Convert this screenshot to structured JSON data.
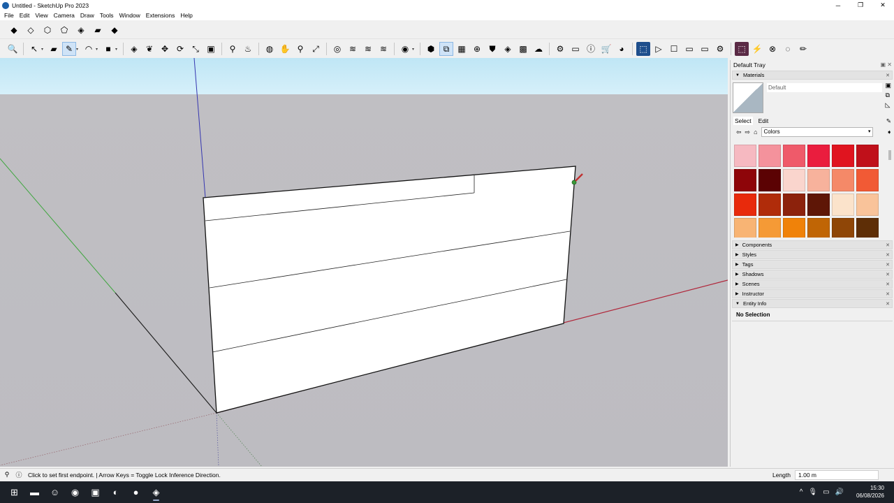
{
  "window": {
    "title": "Untitled - SketchUp Pro 2023",
    "minimize": "─",
    "maximize": "❐",
    "close": "✕"
  },
  "menu": [
    "File",
    "Edit",
    "View",
    "Camera",
    "Draw",
    "Tools",
    "Window",
    "Extensions",
    "Help"
  ],
  "toolbar1": {
    "icons": [
      "iso-view-icon",
      "top-view-icon",
      "front-view-icon",
      "right-view-icon",
      "back-view-icon",
      "left-view-icon",
      "bottom-view-icon"
    ],
    "glyphs": [
      "◆",
      "◇",
      "⬡",
      "⬠",
      "◈",
      "▰",
      "◆"
    ]
  },
  "toolbar2": {
    "groups": [
      [
        {
          "name": "zoom-icon",
          "glyph": "🔍"
        }
      ],
      [
        {
          "name": "select-icon",
          "glyph": "↖",
          "drop": true
        },
        {
          "name": "eraser-icon",
          "glyph": "▰"
        },
        {
          "name": "line-icon",
          "glyph": "✎",
          "active": true,
          "drop": true
        },
        {
          "name": "arc-icon",
          "glyph": "◠",
          "drop": true
        },
        {
          "name": "shape-icon",
          "glyph": "■",
          "drop": true
        }
      ],
      [
        {
          "name": "push-pull-icon",
          "glyph": "◈"
        },
        {
          "name": "follow-me-icon",
          "glyph": "❦"
        },
        {
          "name": "move-icon",
          "glyph": "✥"
        },
        {
          "name": "rotate-icon",
          "glyph": "⟳"
        },
        {
          "name": "scale-icon",
          "glyph": "⤡"
        },
        {
          "name": "offset-icon",
          "glyph": "▣"
        }
      ],
      [
        {
          "name": "tape-measure-icon",
          "glyph": "⚲"
        },
        {
          "name": "paint-bucket-icon",
          "glyph": "♨"
        }
      ],
      [
        {
          "name": "orbit-icon",
          "glyph": "◍"
        },
        {
          "name": "pan-icon",
          "glyph": "✋"
        },
        {
          "name": "zoom-tool-icon",
          "glyph": "⚲"
        },
        {
          "name": "zoom-extents-icon",
          "glyph": "⤢"
        }
      ],
      [
        {
          "name": "solid-tools-icon",
          "glyph": "◎"
        },
        {
          "name": "section-plane-icon",
          "glyph": "≋"
        },
        {
          "name": "section-display-icon",
          "glyph": "≋"
        },
        {
          "name": "section-fill-icon",
          "glyph": "≋"
        }
      ],
      [
        {
          "name": "account-icon",
          "glyph": "◉",
          "drop": true
        }
      ],
      [
        {
          "name": "warehouse-icon",
          "glyph": "⬢"
        },
        {
          "name": "components-icon",
          "glyph": "⧉",
          "active": true
        },
        {
          "name": "extension-manager-icon",
          "glyph": "▦"
        },
        {
          "name": "add-location-icon",
          "glyph": "⊕"
        },
        {
          "name": "shield-icon",
          "glyph": "⛊"
        },
        {
          "name": "layers-icon",
          "glyph": "◈"
        },
        {
          "name": "checker-icon",
          "glyph": "▩"
        },
        {
          "name": "cloud-icon",
          "glyph": "☁"
        }
      ],
      [
        {
          "name": "settings-cog-icon",
          "glyph": "⚙"
        },
        {
          "name": "folder-icon",
          "glyph": "▭"
        },
        {
          "name": "info-icon",
          "glyph": "ⓘ"
        },
        {
          "name": "cart-icon",
          "glyph": "🛒"
        },
        {
          "name": "profile-icon",
          "glyph": "◕"
        }
      ],
      [
        {
          "name": "trimble-connect-icon",
          "glyph": "⬚",
          "style": "dark"
        },
        {
          "name": "play-icon",
          "glyph": "▷"
        },
        {
          "name": "stop-icon",
          "glyph": "☐"
        },
        {
          "name": "camera-icon",
          "glyph": "▭"
        },
        {
          "name": "video-icon",
          "glyph": "▭"
        },
        {
          "name": "gear-icon",
          "glyph": "⚙"
        }
      ],
      [
        {
          "name": "v-ray-icon",
          "glyph": "⬚",
          "style": "plum"
        },
        {
          "name": "lightning-icon",
          "glyph": "⚡"
        },
        {
          "name": "close-circle-icon",
          "glyph": "⊗"
        },
        {
          "name": "bulb-icon",
          "glyph": "◌"
        },
        {
          "name": "pencil-icon",
          "glyph": "✏"
        }
      ]
    ]
  },
  "tray": {
    "title": "Default Tray",
    "materials": {
      "label": "Materials",
      "material_name": "Default",
      "tab_select": "Select",
      "tab_edit": "Edit",
      "collection": "Colors",
      "swatches": [
        "#f6b9c1",
        "#f4929c",
        "#ef5a6a",
        "#ea1d3e",
        "#e0141f",
        "#c0101a",
        "#8e0509",
        "#5b0203",
        "#fad5cd",
        "#f7b29c",
        "#f58968",
        "#f15a35",
        "#e82a0c",
        "#b02c0a",
        "#8c220c",
        "#5e1606",
        "#fbe3cb",
        "#f9c39a",
        "#f8b474",
        "#f59a36",
        "#f08209",
        "#c06505",
        "#8f4607",
        "#5e2e06"
      ]
    },
    "panels": [
      "Components",
      "Styles",
      "Tags",
      "Shadows",
      "Scenes",
      "Instructor"
    ],
    "entity_info": {
      "label": "Entity Info",
      "content": "No Selection"
    }
  },
  "status": {
    "message": "Click to set first endpoint. | Arrow Keys = Toggle Lock Inference Direction.",
    "measure_label": "Length",
    "measure_value": "1.00 m"
  },
  "taskbar": {
    "apps": [
      {
        "name": "start-icon",
        "glyph": "⊞"
      },
      {
        "name": "file-explorer-icon",
        "glyph": "▬"
      },
      {
        "name": "discord-icon",
        "glyph": "☺"
      },
      {
        "name": "chrome-icon",
        "glyph": "◉"
      },
      {
        "name": "app-icon",
        "glyph": "▣"
      },
      {
        "name": "steam-icon",
        "glyph": "◐"
      },
      {
        "name": "spotify-icon",
        "glyph": "●"
      },
      {
        "name": "sketchup-icon",
        "glyph": "◈",
        "open": true
      }
    ],
    "tray_icons": [
      "^",
      "🎙",
      "▭",
      "🔊"
    ],
    "time": "15:30",
    "date": "06/08/2026"
  },
  "colors": {
    "sky": "#d3eef9",
    "ground": "#bfbec3",
    "axis_red": "#b0263a",
    "axis_green": "#40a640",
    "axis_blue": "#3536b0",
    "accent": "#0078d7"
  }
}
